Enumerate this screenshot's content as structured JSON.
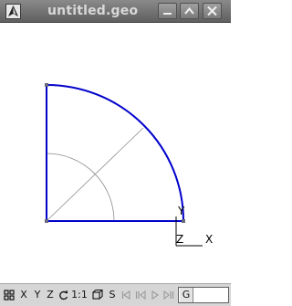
{
  "window": {
    "title": "untitled.geo"
  },
  "titlebar": {
    "icons": {
      "app": "gmsh-app-icon",
      "minimize": "minimize-icon",
      "maximize": "maximize-icon",
      "close": "close-icon"
    }
  },
  "viewport": {
    "axes": {
      "y_label": "Y",
      "z_label": "Z",
      "x_label": "X"
    },
    "colors": {
      "curve": "#0000cc",
      "point": "#6a6a7a",
      "construction": "#8c8c8c"
    }
  },
  "toolbar": {
    "x_label": "X",
    "y_label": "Y",
    "z_label": "Z",
    "scale_label": "1:1",
    "s_label": "S",
    "status_label": "G",
    "icons": {
      "tiles": "tiles-icon",
      "rotate": "rotate-icon",
      "ortho": "ortho-cube-icon",
      "first": "first-frame-icon",
      "prev": "previous-frame-icon",
      "play": "play-icon",
      "next": "next-frame-icon"
    }
  }
}
